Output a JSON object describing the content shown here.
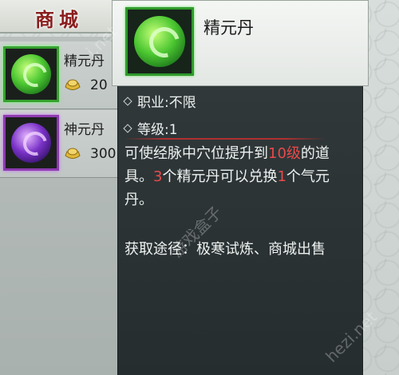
{
  "shop": {
    "title": "商城",
    "items": [
      {
        "name": "精元丹",
        "price": "20",
        "icon": "green-pill-icon"
      },
      {
        "name": "神元丹",
        "price": "300",
        "icon": "purple-pill-icon"
      }
    ]
  },
  "tooltip": {
    "title": "精元丹",
    "icon": "green-pill-icon",
    "profession_label": "职业:",
    "profession_value": "不限",
    "level_label": "等级:",
    "level_value": "1",
    "desc": {
      "p1": "可使经脉中穴位提升到",
      "p2": "10级",
      "p3": "的道具。",
      "p4": "3",
      "p5": "个精元丹可以兑换",
      "p6": "1",
      "p7": "个气元丹。"
    },
    "source": "获取途径：极寒试炼、商城出售"
  },
  "watermarks": [
    "i.net",
    "游戏盒子",
    "hezi.net"
  ],
  "colors": {
    "highlight": "#e84a4a",
    "green_border": "#36a12f",
    "purple_border": "#8d3ab0"
  }
}
